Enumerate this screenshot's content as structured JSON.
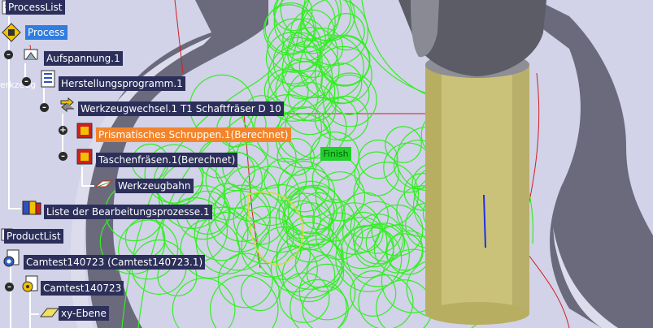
{
  "viewport": {
    "finish_label": "Finish",
    "toolpath_color": "#33ee22",
    "tool_color": "#c8c070",
    "part_color": "#6a6a7a",
    "background_color": "#cfcfe6"
  },
  "side_text": "erkzeug",
  "tree": {
    "process_list": "ProcessList",
    "process": "Process",
    "aufspannung": "Aufspannung.1",
    "herstellungsprogramm": "Herstellungsprogramm.1",
    "werkzeugwechsel": "Werkzeugwechsel.1  T1 Schaftfräser D 10",
    "schruppen": "Prismatisches Schruppen.1(Berechnet)",
    "taschenfraesen": "Taschenfräsen.1(Berechnet)",
    "werkzeugbahn": "Werkzeugbahn",
    "liste": "Liste der Bearbeitungsprozesse.1",
    "product_list": "ProductList",
    "camtest_product": "Camtest140723 (Camtest140723.1)",
    "camtest_part": "Camtest140723",
    "xy_ebene": "xy-Ebene"
  }
}
